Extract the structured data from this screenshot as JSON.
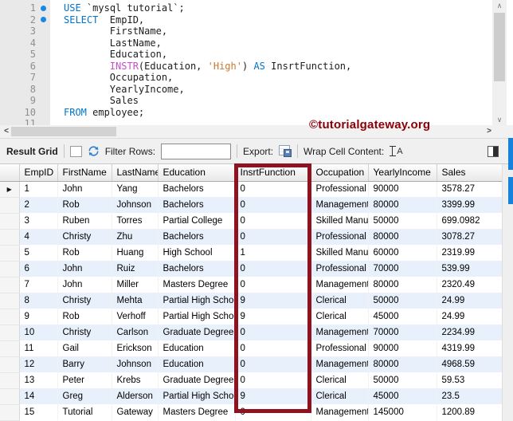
{
  "editor": {
    "lines": [
      {
        "num": "1",
        "marker": true,
        "tokens": [
          [
            "kw",
            "USE"
          ],
          [
            "pl",
            " "
          ],
          [
            "id",
            "`mysql tutorial`"
          ],
          [
            "pl",
            ";"
          ]
        ]
      },
      {
        "num": "2",
        "marker": true,
        "tokens": [
          [
            "kw",
            "SELECT"
          ],
          [
            "pl",
            "  EmpID,"
          ]
        ]
      },
      {
        "num": "3",
        "marker": false,
        "tokens": [
          [
            "pl",
            "        FirstName,"
          ]
        ]
      },
      {
        "num": "4",
        "marker": false,
        "tokens": [
          [
            "pl",
            "        LastName,"
          ]
        ]
      },
      {
        "num": "5",
        "marker": false,
        "tokens": [
          [
            "pl",
            "        Education,"
          ]
        ]
      },
      {
        "num": "6",
        "marker": false,
        "tokens": [
          [
            "pl",
            "        "
          ],
          [
            "fn",
            "INSTR"
          ],
          [
            "pl",
            "(Education, "
          ],
          [
            "str",
            "'High'"
          ],
          [
            "pl",
            ") "
          ],
          [
            "kw",
            "AS"
          ],
          [
            "pl",
            " InsrtFunction,"
          ]
        ]
      },
      {
        "num": "7",
        "marker": false,
        "tokens": [
          [
            "pl",
            "        Occupation,"
          ]
        ]
      },
      {
        "num": "8",
        "marker": false,
        "tokens": [
          [
            "pl",
            "        YearlyIncome,"
          ]
        ]
      },
      {
        "num": "9",
        "marker": false,
        "tokens": [
          [
            "pl",
            "        Sales"
          ]
        ]
      },
      {
        "num": "10",
        "marker": false,
        "tokens": [
          [
            "kw",
            "FROM"
          ],
          [
            "pl",
            " employee;"
          ]
        ]
      },
      {
        "num": "11",
        "marker": false,
        "tokens": []
      }
    ]
  },
  "watermark": "©tutorialgateway.org",
  "toolbar": {
    "result_grid_label": "Result Grid",
    "filter_rows_label": "Filter Rows:",
    "filter_value": "",
    "export_label": "Export:",
    "wrap_label": "Wrap Cell Content:",
    "wrap_icon_letter": "A"
  },
  "icons": {
    "scroll_up": "∧",
    "scroll_down": "∨",
    "scroll_left": "<",
    "scroll_right": ">",
    "row_marker": "▶"
  },
  "grid": {
    "columns": [
      "EmpID",
      "FirstName",
      "LastName",
      "Education",
      "InsrtFunction",
      "Occupation",
      "YearlyIncome",
      "Sales"
    ],
    "highlighted_column": "InsrtFunction",
    "highlight_color": "#8e1220",
    "rows": [
      [
        "1",
        "John",
        "Yang",
        "Bachelors",
        "0",
        "Professional",
        "90000",
        "3578.27"
      ],
      [
        "2",
        "Rob",
        "Johnson",
        "Bachelors",
        "0",
        "Management",
        "80000",
        "3399.99"
      ],
      [
        "3",
        "Ruben",
        "Torres",
        "Partial College",
        "0",
        "Skilled Manual",
        "50000",
        "699.0982"
      ],
      [
        "4",
        "Christy",
        "Zhu",
        "Bachelors",
        "0",
        "Professional",
        "80000",
        "3078.27"
      ],
      [
        "5",
        "Rob",
        "Huang",
        "High School",
        "1",
        "Skilled Manual",
        "60000",
        "2319.99"
      ],
      [
        "6",
        "John",
        "Ruiz",
        "Bachelors",
        "0",
        "Professional",
        "70000",
        "539.99"
      ],
      [
        "7",
        "John",
        "Miller",
        "Masters Degree",
        "0",
        "Management",
        "80000",
        "2320.49"
      ],
      [
        "8",
        "Christy",
        "Mehta",
        "Partial High School",
        "9",
        "Clerical",
        "50000",
        "24.99"
      ],
      [
        "9",
        "Rob",
        "Verhoff",
        "Partial High School",
        "9",
        "Clerical",
        "45000",
        "24.99"
      ],
      [
        "10",
        "Christy",
        "Carlson",
        "Graduate Degree",
        "0",
        "Management",
        "70000",
        "2234.99"
      ],
      [
        "11",
        "Gail",
        "Erickson",
        "Education",
        "0",
        "Professional",
        "90000",
        "4319.99"
      ],
      [
        "12",
        "Barry",
        "Johnson",
        "Education",
        "0",
        "Management",
        "80000",
        "4968.59"
      ],
      [
        "13",
        "Peter",
        "Krebs",
        "Graduate Degree",
        "0",
        "Clerical",
        "50000",
        "59.53"
      ],
      [
        "14",
        "Greg",
        "Alderson",
        "Partial High School",
        "9",
        "Clerical",
        "45000",
        "23.5"
      ],
      [
        "15",
        "Tutorial",
        "Gateway",
        "Masters Degree",
        "0",
        "Management",
        "145000",
        "1200.89"
      ]
    ]
  }
}
